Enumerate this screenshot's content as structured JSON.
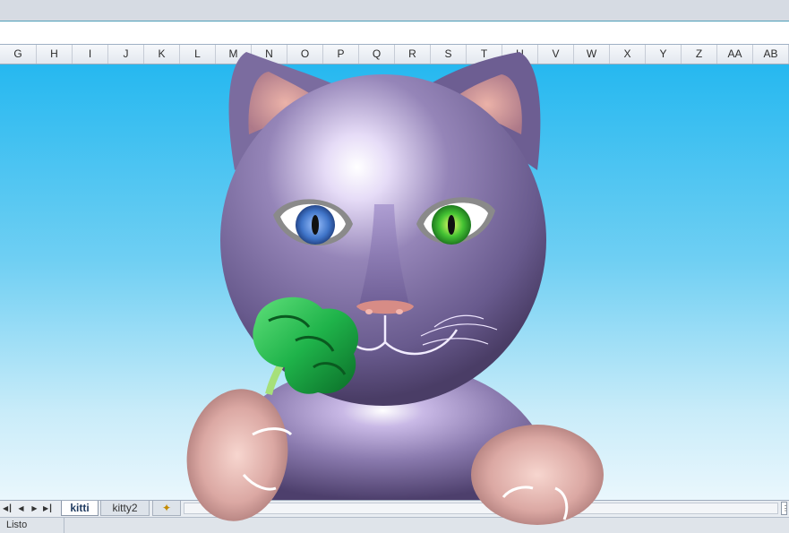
{
  "columns": [
    "G",
    "H",
    "I",
    "J",
    "K",
    "L",
    "M",
    "N",
    "O",
    "P",
    "Q",
    "R",
    "S",
    "T",
    "U",
    "V",
    "W",
    "X",
    "Y",
    "Z",
    "AA",
    "AB"
  ],
  "sheet_tabs": {
    "active": "kitti",
    "other": "kitty2"
  },
  "status": {
    "text": "Listo"
  },
  "colors": {
    "sky_top": "#26b8f0",
    "sky_bottom": "#eaf7fd",
    "cat_body": "#7a6a9c",
    "cat_ear_inner": "#e59a92",
    "eye_left_iris": "#3f74c8",
    "eye_right_iris": "#44c233",
    "nose": "#d78c86",
    "broccoli": "#1fb34a",
    "paw": "#e6b3ad"
  },
  "icons": [
    "first-sheet-icon",
    "prev-sheet-icon",
    "next-sheet-icon",
    "last-sheet-icon",
    "insert-sheet-icon",
    "split-handle-icon"
  ]
}
